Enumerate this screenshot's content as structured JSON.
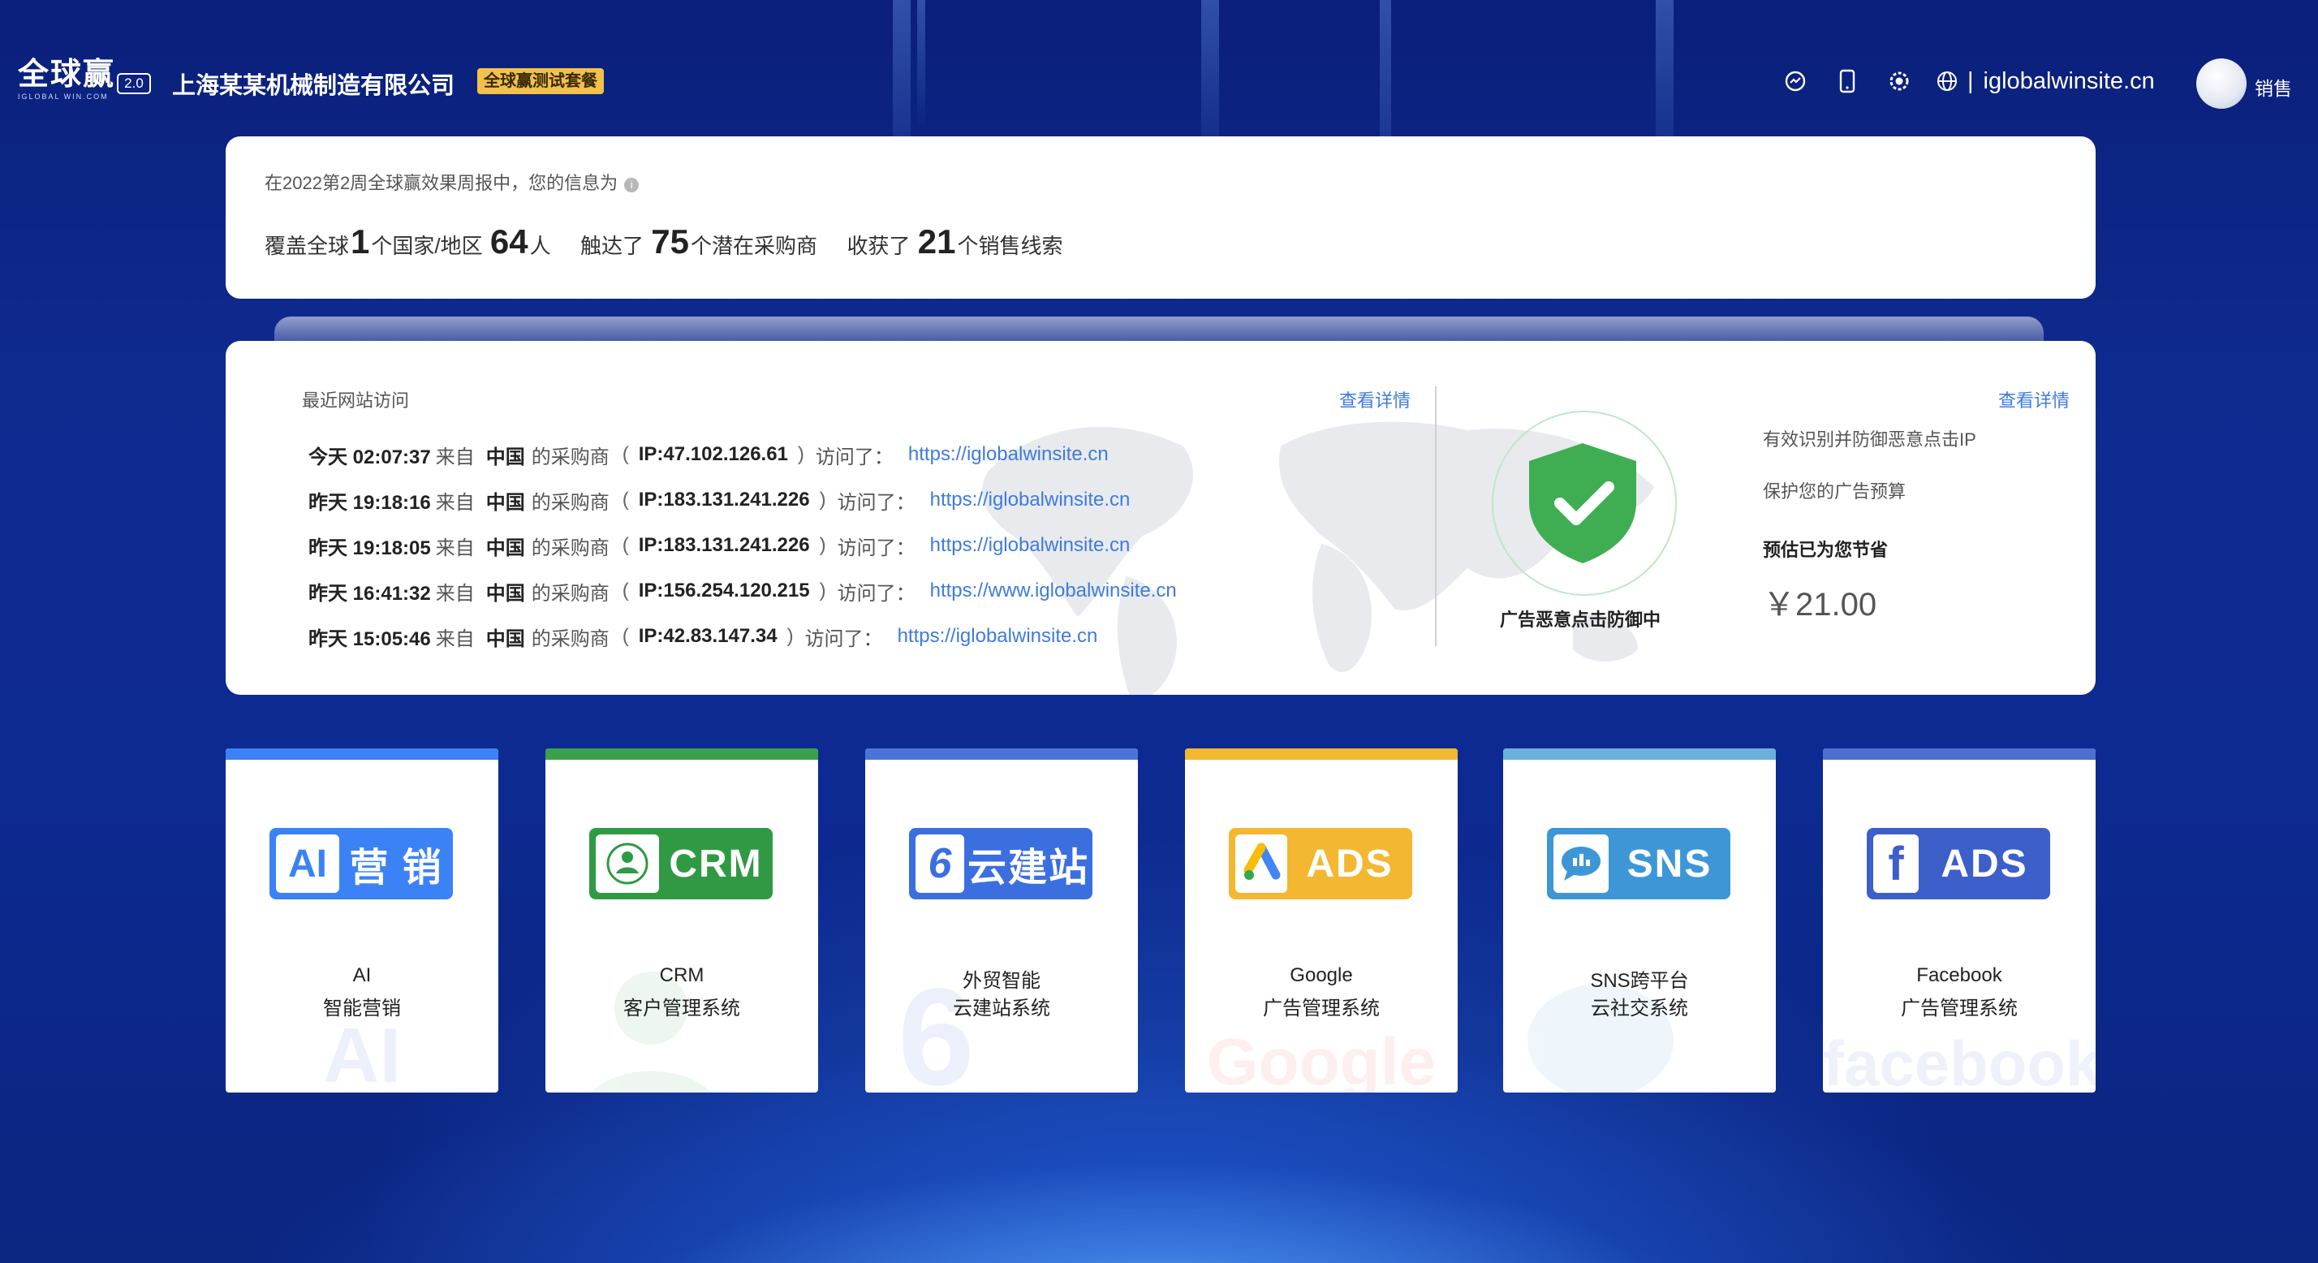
{
  "header": {
    "logo_main": "全球赢",
    "logo_sub": "IGLOBAL WIN.COM",
    "version": "2.0",
    "company": "上海某某机械制造有限公司",
    "plan_badge": "全球赢测试套餐",
    "icons": [
      "message-icon",
      "mobile-icon",
      "settings-icon",
      "globe-icon"
    ],
    "site": "iglobalwinsite.cn",
    "user_name": "销售"
  },
  "summary": {
    "intro": "在2022第2周全球赢效果周报中，您的信息为",
    "info_glyph": "i",
    "cover_label": "覆盖全球",
    "countries": "1",
    "countries_unit": "个国家/地区",
    "people": "64",
    "people_unit": "人",
    "reach_label": "触达了",
    "buyers": "75",
    "buyers_unit": "个潜在采购商",
    "gain_label": "收获了",
    "leads": "21",
    "leads_unit": "个销售线索"
  },
  "visits": {
    "title": "最近网站访问",
    "detail_link": "查看详情",
    "from_label": "来自",
    "buyer_label": "的采购商",
    "visited_label": "访问了：",
    "rows": [
      {
        "time": "今天 02:07:37",
        "country": "中国",
        "ip": "IP:47.102.126.61",
        "url": "https://iglobalwinsite.cn"
      },
      {
        "time": "昨天 19:18:16",
        "country": "中国",
        "ip": "IP:183.131.241.226",
        "url": "https://iglobalwinsite.cn"
      },
      {
        "time": "昨天 19:18:05",
        "country": "中国",
        "ip": "IP:183.131.241.226",
        "url": "https://iglobalwinsite.cn"
      },
      {
        "time": "昨天 16:41:32",
        "country": "中国",
        "ip": "IP:156.254.120.215",
        "url": "https://www.iglobalwinsite.cn"
      },
      {
        "time": "昨天 15:05:46",
        "country": "中国",
        "ip": "IP:42.83.147.34",
        "url": "https://iglobalwinsite.cn"
      }
    ]
  },
  "protection": {
    "detail_link": "查看详情",
    "status_label": "广告恶意点击防御中",
    "line1": "有效识别并防御恶意点击IP",
    "line2": "保护您的广告预算",
    "line3": "预估已为您节省",
    "savings": "￥21.00"
  },
  "tiles": [
    {
      "badge_text": "营 销",
      "badge_symbol": "AI",
      "title": "AI",
      "subtitle": "智能营销",
      "bar_color": "#3b82f6",
      "badge_color": "#3b82f6",
      "watermark": "AI"
    },
    {
      "badge_text": "CRM",
      "badge_symbol": "CRM",
      "title": "CRM",
      "subtitle": "客户管理系统",
      "bar_color": "#3aa14a",
      "badge_color": "#2f9a43",
      "watermark": ""
    },
    {
      "badge_text": "云建站",
      "badge_symbol": "6",
      "title": "外贸智能",
      "subtitle": "云建站系统",
      "bar_color": "#4a74d9",
      "badge_color": "#3b6fe0",
      "watermark": "6"
    },
    {
      "badge_text": "ADS",
      "badge_symbol": "A",
      "title": "Google",
      "subtitle": "广告管理系统",
      "bar_color": "#f2b830",
      "badge_color": "#f4b731",
      "watermark": "Google"
    },
    {
      "badge_text": "SNS",
      "badge_symbol": "chat",
      "title": "SNS跨平台",
      "subtitle": "云社交系统",
      "bar_color": "#6ab0d8",
      "badge_color": "#3d97d6",
      "watermark": ""
    },
    {
      "badge_text": "ADS",
      "badge_symbol": "f",
      "title": "Facebook",
      "subtitle": "广告管理系统",
      "bar_color": "#4f6fcf",
      "badge_color": "#3c5fc9",
      "watermark": "facebook"
    }
  ]
}
